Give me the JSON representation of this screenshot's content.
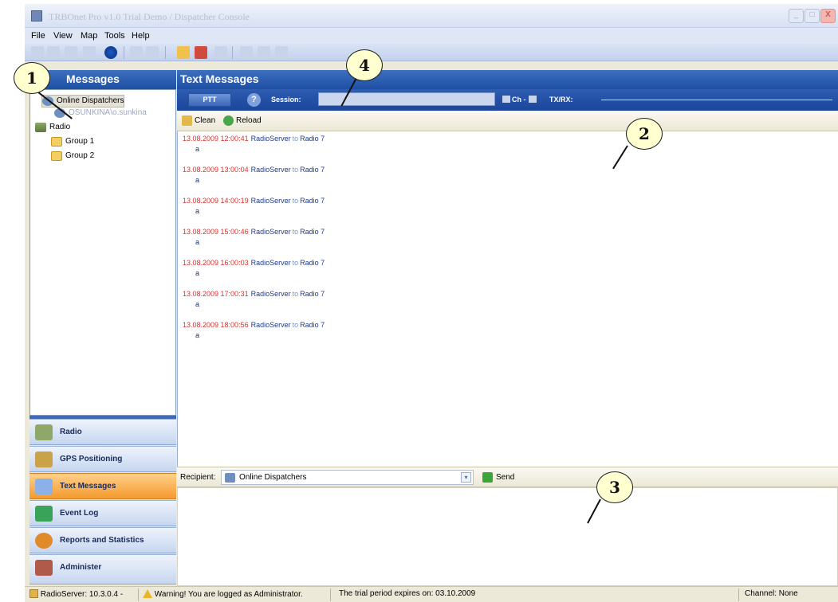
{
  "window": {
    "title": "TRBOnet Pro v1.0 Trial Demo / Dispatcher Console",
    "controls": {
      "minimize": "_",
      "maximize": "□",
      "close": "X"
    }
  },
  "menu": [
    "File",
    "View",
    "Map",
    "Tools",
    "Help"
  ],
  "left_panel": {
    "title": "Messages",
    "tree": [
      {
        "label": "Online Dispatchers",
        "level": 0,
        "icon": "dispatcher-icon",
        "selected": true
      },
      {
        "label": "OSUNKINA\\o.sunkina",
        "level": 1,
        "icon": "user-icon"
      },
      {
        "label": "Radio",
        "level": 0,
        "icon": "radio-icon"
      },
      {
        "label": "Group 1",
        "level": 1,
        "icon": "folder-icon"
      },
      {
        "label": "Group 2",
        "level": 1,
        "icon": "folder-icon"
      }
    ]
  },
  "nav": [
    {
      "label": "Radio",
      "icon": "radio-icon",
      "active": false,
      "color": "#8fa86a"
    },
    {
      "label": "GPS Positioning",
      "icon": "gps-icon",
      "active": false,
      "color": "#c9a24a"
    },
    {
      "label": "Text Messages",
      "icon": "envelope-icon",
      "active": true,
      "color": "#8cb0e8"
    },
    {
      "label": "Event Log",
      "icon": "log-icon",
      "active": false,
      "color": "#3aa35a"
    },
    {
      "label": "Reports and Statistics",
      "icon": "reports-icon",
      "active": false,
      "color": "#e08a2a"
    },
    {
      "label": "Administer",
      "icon": "admin-icon",
      "active": false,
      "color": "#b05a4a"
    }
  ],
  "main": {
    "title": "Text Messages",
    "ptt_label": "PTT",
    "help_label": "?",
    "session_label": "Session:",
    "session_value": "",
    "ch_label": "Ch -",
    "txrx_label": "TX/RX:",
    "toolbar": {
      "clean_label": "Clean",
      "reload_label": "Reload"
    },
    "messages": [
      {
        "timestamp": "13.08.2009 12:00:41",
        "sender": "RadioServer",
        "to": "to",
        "recipient": "Radio 7",
        "body": "a"
      },
      {
        "timestamp": "13.08.2009 13:00:04",
        "sender": "RadioServer",
        "to": "to",
        "recipient": "Radio 7",
        "body": "a"
      },
      {
        "timestamp": "13.08.2009 14:00:19",
        "sender": "RadioServer",
        "to": "to",
        "recipient": "Radio 7",
        "body": "a"
      },
      {
        "timestamp": "13.08.2009 15:00:46",
        "sender": "RadioServer",
        "to": "to",
        "recipient": "Radio 7",
        "body": "a"
      },
      {
        "timestamp": "13.08.2009 16:00:03",
        "sender": "RadioServer",
        "to": "to",
        "recipient": "Radio 7",
        "body": "a"
      },
      {
        "timestamp": "13.08.2009 17:00:31",
        "sender": "RadioServer",
        "to": "to",
        "recipient": "Radio 7",
        "body": "a"
      },
      {
        "timestamp": "13.08.2009 18:00:56",
        "sender": "RadioServer",
        "to": "to",
        "recipient": "Radio 7",
        "body": "a"
      }
    ],
    "recipient_label": "Recipient:",
    "recipient_value": "Online Dispatchers",
    "send_label": "Send",
    "compose_value": ""
  },
  "status": {
    "server": "RadioServer: 10.3.0.4 -",
    "warning": "Warning! You are logged as Administrator.",
    "trial": "The trial period expires on: 03.10.2009",
    "channel": "Channel: None"
  },
  "callouts": [
    "1",
    "2",
    "3",
    "4"
  ]
}
